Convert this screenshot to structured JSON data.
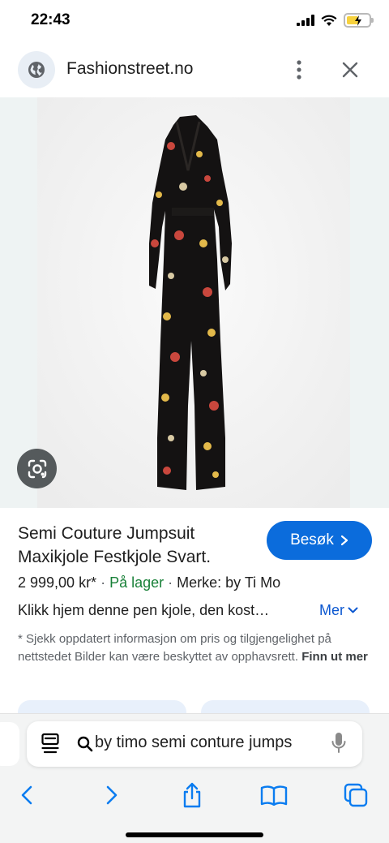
{
  "status": {
    "time": "22:43",
    "battery_level": 0.55,
    "battery_color": "#f7d23e"
  },
  "header": {
    "site": "Fashionstreet.no",
    "icons": [
      "globe-icon",
      "more-vertical-icon",
      "close-icon"
    ]
  },
  "product": {
    "title": "Semi Couture Jumpsuit Maxikjole Festkjole Svart.",
    "visit_label": "Besøk",
    "price": "2 999,00 kr*",
    "stock": "På lager",
    "brand": "Merke: by Ti Mo",
    "description": "Klikk hjem denne pen kjole, den kost…",
    "more_label": "Mer",
    "note": "* Sjekk oppdatert informasjon om pris og tilgjengelighet på nettstedet Bilder kan være beskyttet av opphavsrett.",
    "learn_more": "Finn ut mer"
  },
  "address_bar": {
    "text": "by timo semi conture jumps"
  },
  "colors": {
    "accent": "#0b6cdc",
    "stock_green": "#188038",
    "link_blue": "#0b57d0"
  }
}
